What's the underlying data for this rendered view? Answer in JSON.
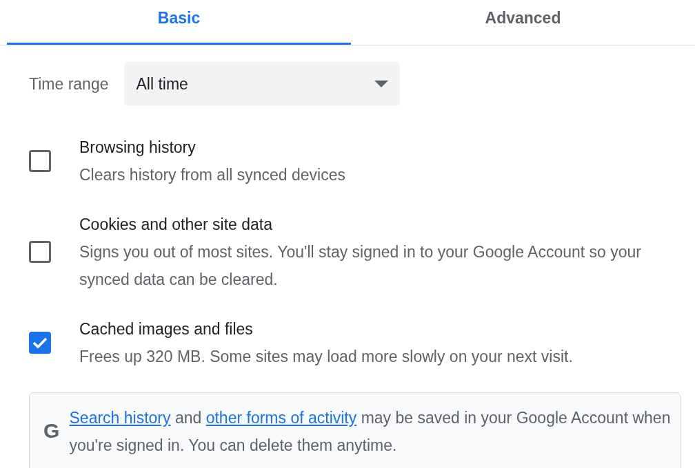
{
  "tabs": [
    {
      "label": "Basic",
      "selected": true
    },
    {
      "label": "Advanced",
      "selected": false
    }
  ],
  "time_range": {
    "label": "Time range",
    "value": "All time"
  },
  "items": [
    {
      "title": "Browsing history",
      "description": "Clears history from all synced devices",
      "checked": false
    },
    {
      "title": "Cookies and other site data",
      "description": "Signs you out of most sites. You'll stay signed in to your Google Account so your synced data can be cleared.",
      "checked": false
    },
    {
      "title": "Cached images and files",
      "description": "Frees up 320 MB. Some sites may load more slowly on your next visit.",
      "checked": true
    }
  ],
  "notice": {
    "icon": "G",
    "segments": [
      {
        "kind": "link",
        "text": "Search history"
      },
      {
        "kind": "text",
        "text": " and "
      },
      {
        "kind": "link",
        "text": "other forms of activity"
      },
      {
        "kind": "text",
        "text": " may be saved in your Google Account when you're signed in. You can delete them anytime."
      }
    ]
  }
}
